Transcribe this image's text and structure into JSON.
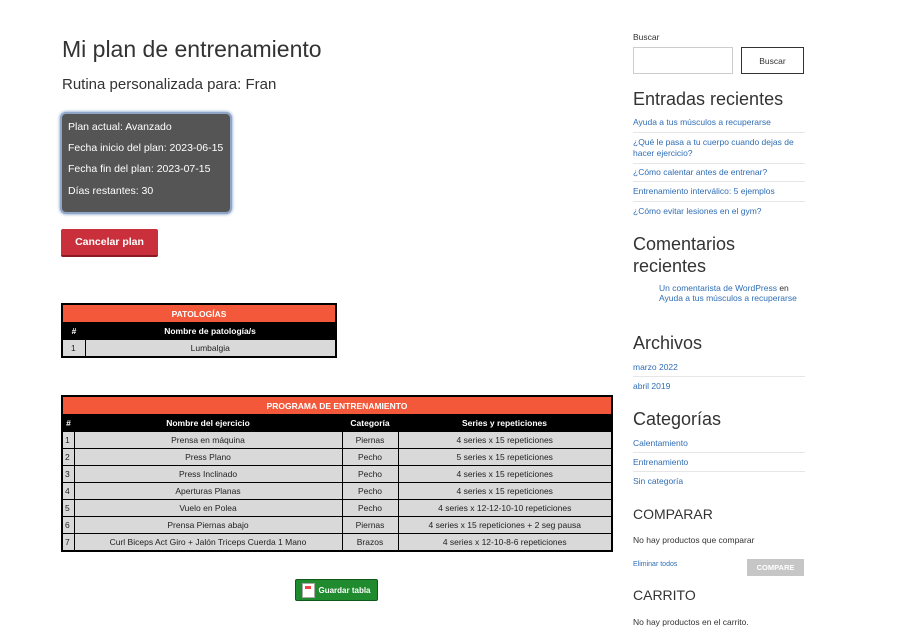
{
  "main": {
    "title": "Mi plan de entrenamiento",
    "subtitle": "Rutina personalizada para: Fran",
    "plan": {
      "current": "Plan actual: Avanzado",
      "start": "Fecha inicio del plan: 2023-06-15",
      "end": "Fecha fin del plan: 2023-07-15",
      "remaining": "Días restantes: 30"
    },
    "cancel_label": "Cancelar plan",
    "pathologies": {
      "title": "PATOLOGÍAS",
      "headers": [
        "#",
        "Nombre de patología/s"
      ],
      "rows": [
        [
          "1",
          "Lumbalgia"
        ]
      ]
    },
    "program": {
      "title": "PROGRAMA DE ENTRENAMIENTO",
      "headers": [
        "#",
        "Nombre del ejercicio",
        "Categoría",
        "Series y repeticiones"
      ],
      "rows": [
        [
          "1",
          "Prensa en máquina",
          "Piernas",
          "4 series x 15 repeticiones"
        ],
        [
          "2",
          "Press Plano",
          "Pecho",
          "5 series x 15 repeticiones"
        ],
        [
          "3",
          "Press Inclinado",
          "Pecho",
          "4 series x 15 repeticiones"
        ],
        [
          "4",
          "Aperturas Planas",
          "Pecho",
          "4 series x 15 repeticiones"
        ],
        [
          "5",
          "Vuelo en Polea",
          "Pecho",
          "4 series x 12-12-10-10 repeticiones"
        ],
        [
          "6",
          "Prensa Piernas abajo",
          "Piernas",
          "4 series x 15 repeticiones + 2 seg pausa"
        ],
        [
          "7",
          "Curl Biceps Act Giro + Jalón Triceps Cuerda 1 Mano",
          "Brazos",
          "4 series x 12-10-8-6 repeticiones"
        ]
      ]
    },
    "save_label": "Guardar tabla"
  },
  "sidebar": {
    "search_label": "Buscar",
    "search_placeholder": "",
    "search_button": "Buscar",
    "recent_posts_title": "Entradas recientes",
    "recent_posts": [
      "Ayuda a tus músculos a recuperarse",
      "¿Qué le pasa a tu cuerpo cuando dejas de hacer ejercicio?",
      "¿Cómo calentar antes de entrenar?",
      "Entrenamiento interválico: 5 ejemplos",
      "¿Cómo evitar lesiones en el gym?"
    ],
    "recent_comments_title_1": "Comentarios",
    "recent_comments_title_2": "recientes",
    "comment_author": "Un comentarista de WordPress",
    "comment_on": " en ",
    "comment_post": "Ayuda a tus músculos a recuperarse",
    "archives_title": "Archivos",
    "archives": [
      "marzo 2022",
      "abril 2019"
    ],
    "categories_title": "Categorías",
    "categories": [
      "Calentamiento",
      "Entrenamiento",
      "Sin categoría"
    ],
    "compare_title": "COMPARAR",
    "compare_empty": "No hay productos que comparar",
    "compare_clear": "Eliminar todos",
    "compare_button": "COMPARE",
    "cart_title": "CARRITO",
    "cart_empty": "No hay productos en el carrito."
  },
  "colors": {
    "accent_orange": "#f3583a",
    "cancel_red": "#c9303b",
    "save_green": "#1f8a2e",
    "link_blue": "#2f6db5",
    "plan_box_bg": "#555555"
  }
}
